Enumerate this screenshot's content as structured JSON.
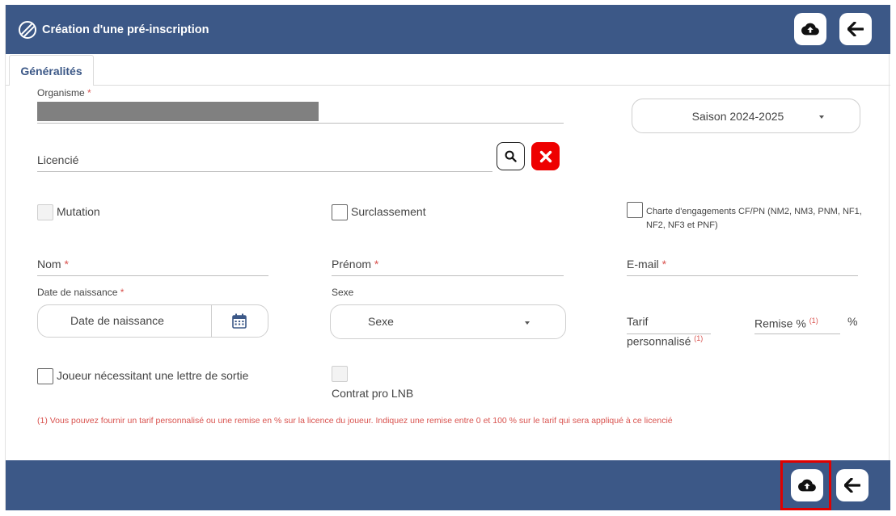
{
  "header": {
    "title": "Création d'une pré-inscription",
    "save_icon": "cloud-upload-icon",
    "back_icon": "arrow-left-icon"
  },
  "tabs": [
    {
      "label": "Généralités"
    }
  ],
  "form": {
    "organisme": {
      "label": "Organisme",
      "required_mark": "*"
    },
    "saison": {
      "value": "Saison 2024-2025"
    },
    "licencie": {
      "label": "Licencié"
    },
    "mutation": {
      "label": "Mutation"
    },
    "surclassement": {
      "label": "Surclassement"
    },
    "charte": {
      "label": "Charte d'engagements CF/PN (NM2, NM3, PNM, NF1, NF2, NF3 et PNF)"
    },
    "nom": {
      "label": "Nom",
      "required_mark": "*"
    },
    "prenom": {
      "label": "Prénom",
      "required_mark": "*"
    },
    "email": {
      "label": "E-mail",
      "required_mark": "*"
    },
    "date_naissance": {
      "label": "Date de naissance",
      "required_mark": "*",
      "placeholder": "Date de naissance"
    },
    "sexe": {
      "label": "Sexe",
      "placeholder": "Sexe"
    },
    "tarif": {
      "label_line1": "Tarif",
      "label_line2": "personnalisé",
      "note": "(1)"
    },
    "remise": {
      "label": "Remise %",
      "note": "(1)",
      "unit": "%"
    },
    "lettre_sortie": {
      "label": "Joueur nécessitant une lettre de sortie"
    },
    "contrat_lnb": {
      "label": "Contrat pro LNB"
    },
    "footnote": "(1) Vous pouvez fournir un tarif personnalisé ou une remise en % sur la licence du joueur. Indiquez une remise entre 0 et 100 % sur le tarif qui sera appliqué à ce licencié"
  },
  "colors": {
    "primary": "#3c5887",
    "danger": "#ee0000",
    "required": "#d9534f",
    "highlight": "#e00000"
  }
}
